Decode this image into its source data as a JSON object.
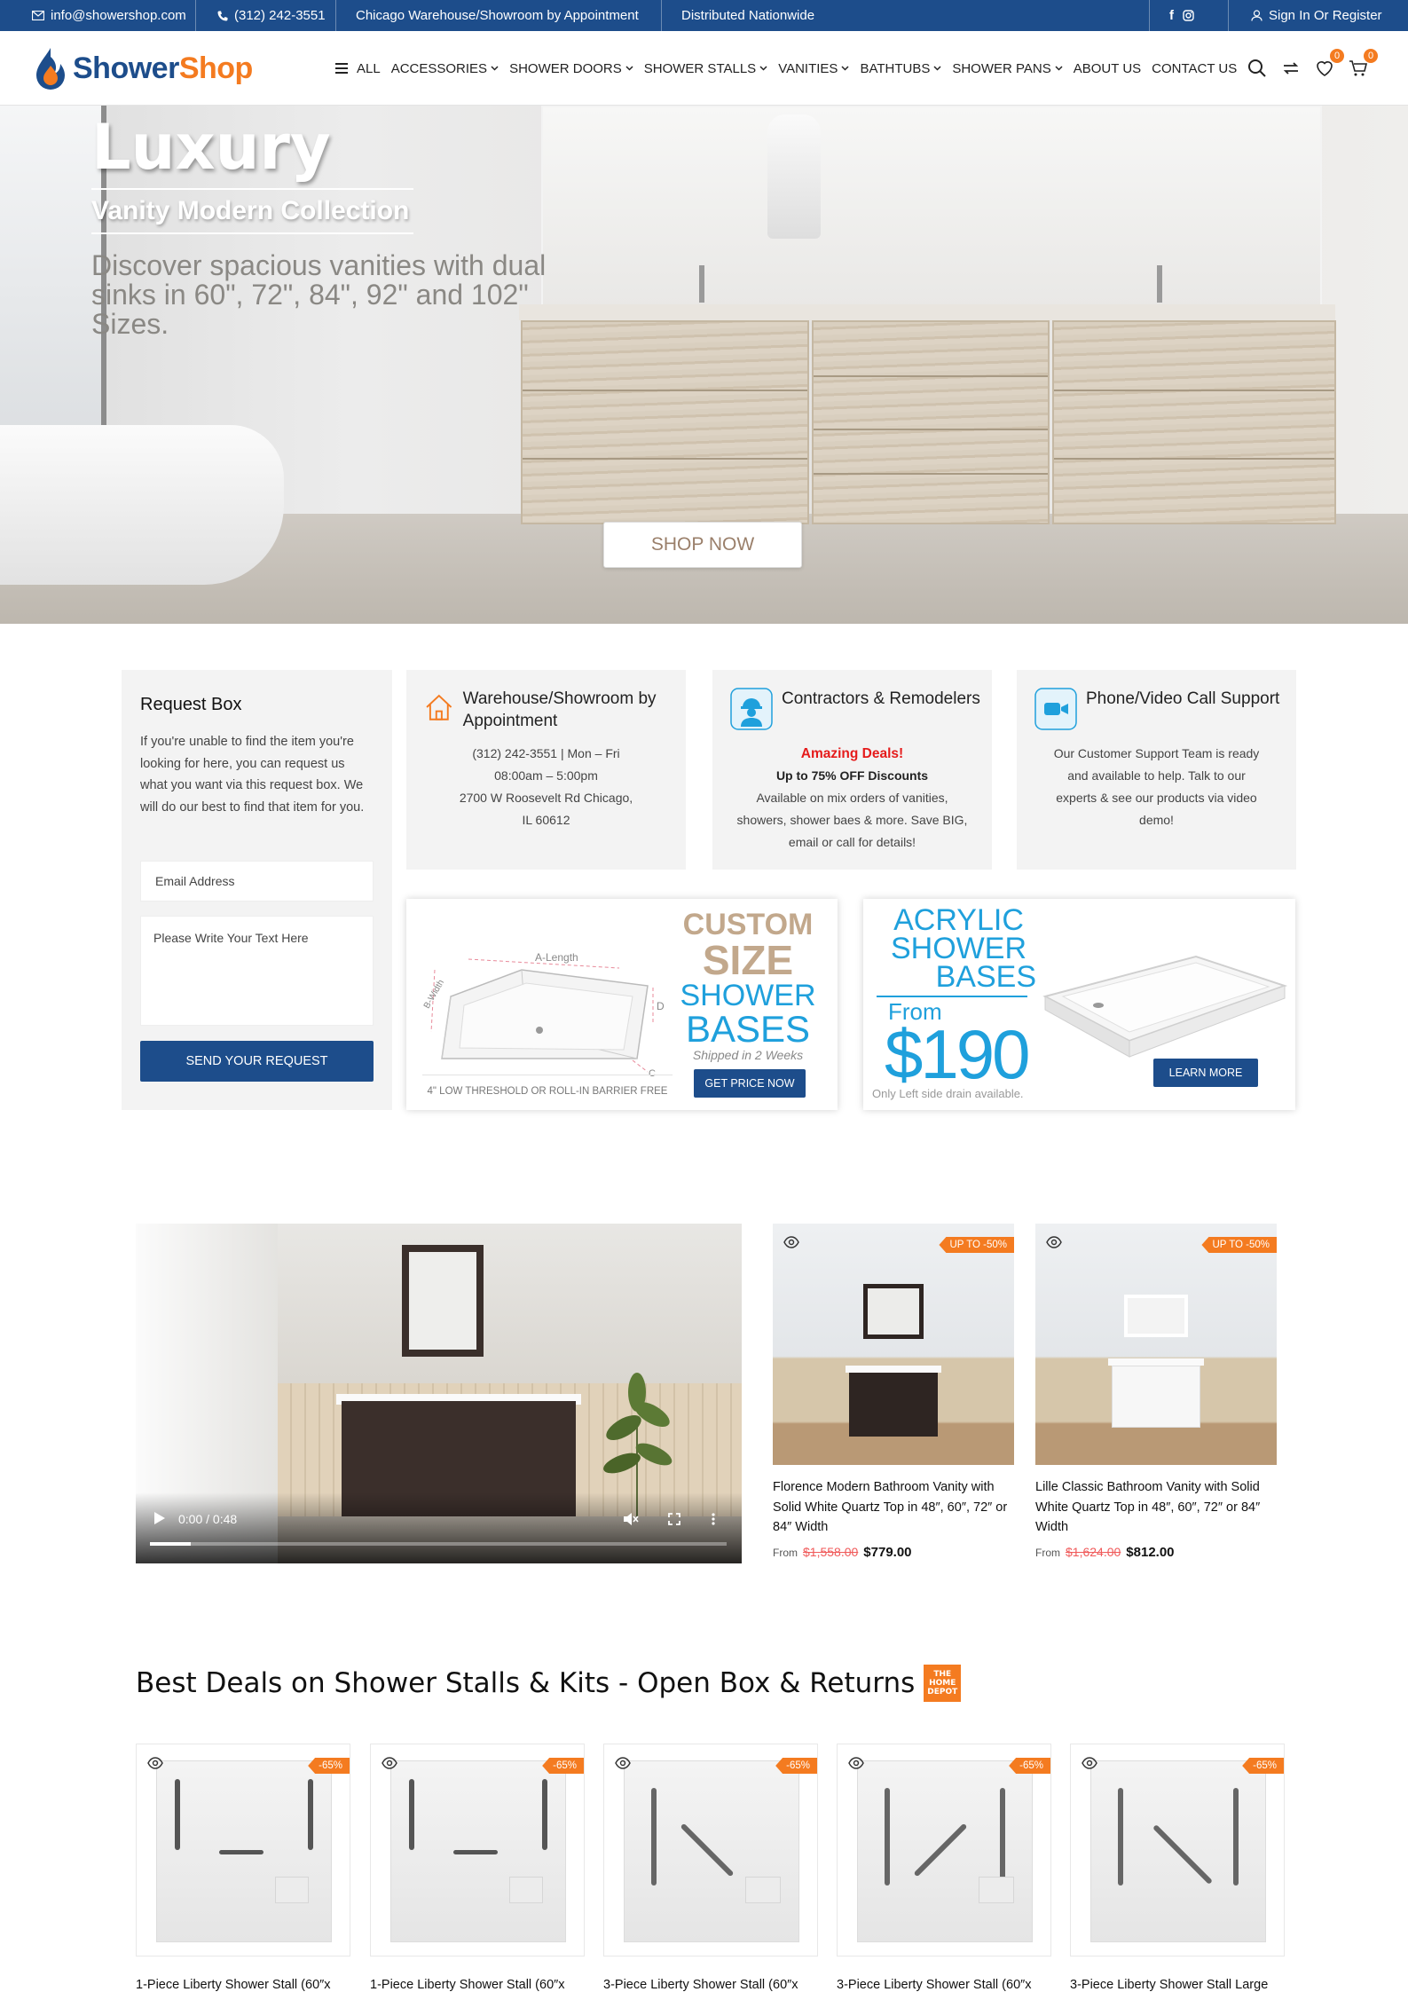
{
  "topbar": {
    "email": "info@showershop.com",
    "phone": "(312) 242-3551",
    "warehouse": "Chicago Warehouse/Showroom by Appointment",
    "distributed": "Distributed Nationwide",
    "signin": "Sign In Or Register"
  },
  "header": {
    "logo_part1": "Shower",
    "logo_part2": "Shop",
    "nav": [
      "ALL",
      "ACCESSORIES",
      "SHOWER DOORS",
      "SHOWER STALLS",
      "VANITIES",
      "BATHTUBS",
      "SHOWER PANS",
      "ABOUT US",
      "CONTACT US"
    ],
    "wishlist_count": "0",
    "cart_count": "0"
  },
  "hero": {
    "title": "Luxury",
    "subtitle": "Vanity Modern Collection",
    "description": "Discover spacious vanities with dual sinks in 60\", 72\", 84\", 92\" and 102\" Sizes.",
    "cta": "SHOP NOW"
  },
  "request_box": {
    "title": "Request Box",
    "text": "If you're unable to find the item you're looking for here, you can request us what you want via this request box. We will do our best to find that item for you.",
    "email_placeholder": "Email Address",
    "text_placeholder": "Please Write Your Text Here",
    "button": "SEND YOUR REQUEST"
  },
  "cards": [
    {
      "title": "Warehouse/Showroom by Appointment",
      "lines": [
        "(312) 242-3551 | Mon – Fri",
        "08:00am – 5:00pm",
        "2700 W Roosevelt Rd Chicago,",
        "IL 60612"
      ]
    },
    {
      "title": "Contractors & Remodelers",
      "highlight": "Amazing Deals!",
      "bold": "Up to 75% OFF Discounts",
      "text": "Available on mix orders of vanities, showers, shower baes & more. Save BIG, email or call for details!"
    },
    {
      "title": "Phone/Video Call Support",
      "text": "Our Customer Support Team is ready and available to help. Talk to our experts & see our products via video demo!"
    }
  ],
  "promo_custom": {
    "l1": "CUSTOM",
    "l2": "SIZE",
    "l3": "SHOWER",
    "l4": "BASES",
    "shipped": "Shipped in 2 Weeks",
    "length": "A-Length",
    "width": "B-Width",
    "dim_c": "C",
    "dim_d": "D",
    "caption": "4\" LOW THRESHOLD OR ROLL-IN BARRIER FREE",
    "button": "GET PRICE NOW"
  },
  "promo_acrylic": {
    "l1": "ACRYLIC",
    "l2": "SHOWER",
    "l3": "BASES",
    "from": "From",
    "price": "$190",
    "note": "Only Left side drain available.",
    "button": "LEARN MORE"
  },
  "video": {
    "time": "0:00 / 0:48"
  },
  "products": [
    {
      "tag": "UP TO -50%",
      "name": "Florence Modern Bathroom Vanity with Solid White Quartz Top in 48″, 60″, 72″ or 84″ Width",
      "from": "From",
      "old_price": "$1,558.00",
      "price": "$779.00"
    },
    {
      "tag": "UP TO -50%",
      "name": "Lille Classic Bathroom Vanity with Solid White Quartz Top in 48″, 60″, 72″ or 84″ Width",
      "from": "From",
      "old_price": "$1,624.00",
      "price": "$812.00"
    }
  ],
  "best_deals": {
    "title": "Best Deals on Shower Stalls & Kits - Open Box & Returns",
    "logo_text": "THE HOME DEPOT",
    "items": [
      {
        "tag": "-65%",
        "name": "1-Piece Liberty Shower Stall (60″x"
      },
      {
        "tag": "-65%",
        "name": "1-Piece Liberty Shower Stall (60″x"
      },
      {
        "tag": "-65%",
        "name": "3-Piece Liberty Shower Stall (60″x"
      },
      {
        "tag": "-65%",
        "name": "3-Piece Liberty Shower Stall (60″x"
      },
      {
        "tag": "-65%",
        "name": "3-Piece Liberty Shower Stall Large"
      }
    ]
  },
  "colors": {
    "primary": "#1d4d8b",
    "accent": "#f47b20",
    "sale": "#f05a5a",
    "highlight": "#e51b1b",
    "cyan": "#1fa0dc"
  }
}
